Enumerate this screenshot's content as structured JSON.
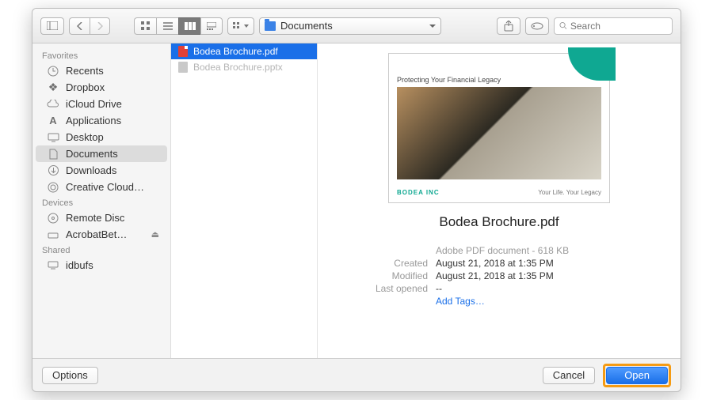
{
  "toolbar": {
    "path_label": "Documents",
    "search_placeholder": "Search"
  },
  "sidebar": {
    "sections": [
      {
        "title": "Favorites",
        "items": [
          {
            "label": "Recents",
            "icon": "clock"
          },
          {
            "label": "Dropbox",
            "icon": "dropbox"
          },
          {
            "label": "iCloud Drive",
            "icon": "cloud"
          },
          {
            "label": "Applications",
            "icon": "apps"
          },
          {
            "label": "Desktop",
            "icon": "desktop"
          },
          {
            "label": "Documents",
            "icon": "doc",
            "selected": true
          },
          {
            "label": "Downloads",
            "icon": "download"
          },
          {
            "label": "Creative Cloud…",
            "icon": "cc"
          }
        ]
      },
      {
        "title": "Devices",
        "items": [
          {
            "label": "Remote Disc",
            "icon": "disc"
          },
          {
            "label": "AcrobatBet…",
            "icon": "drive",
            "eject": true
          }
        ]
      },
      {
        "title": "Shared",
        "items": [
          {
            "label": "idbufs",
            "icon": "host"
          }
        ]
      }
    ]
  },
  "files": [
    {
      "name": "Bodea Brochure.pdf",
      "type": "pdf",
      "selected": true
    },
    {
      "name": "Bodea Brochure.pptx",
      "type": "generic",
      "dim": true
    }
  ],
  "preview": {
    "doc_caption": "Protecting Your Financial Legacy",
    "brand": "BODEA INC",
    "tagline": "Your Life. Your Legacy",
    "filename": "Bodea Brochure.pdf",
    "kind": "Adobe PDF document - 618 KB",
    "created_label": "Created",
    "created_value": "August 21, 2018 at 1:35 PM",
    "modified_label": "Modified",
    "modified_value": "August 21, 2018 at 1:35 PM",
    "opened_label": "Last opened",
    "opened_value": "--",
    "tags_link": "Add Tags…"
  },
  "footer": {
    "options": "Options",
    "cancel": "Cancel",
    "open": "Open"
  }
}
